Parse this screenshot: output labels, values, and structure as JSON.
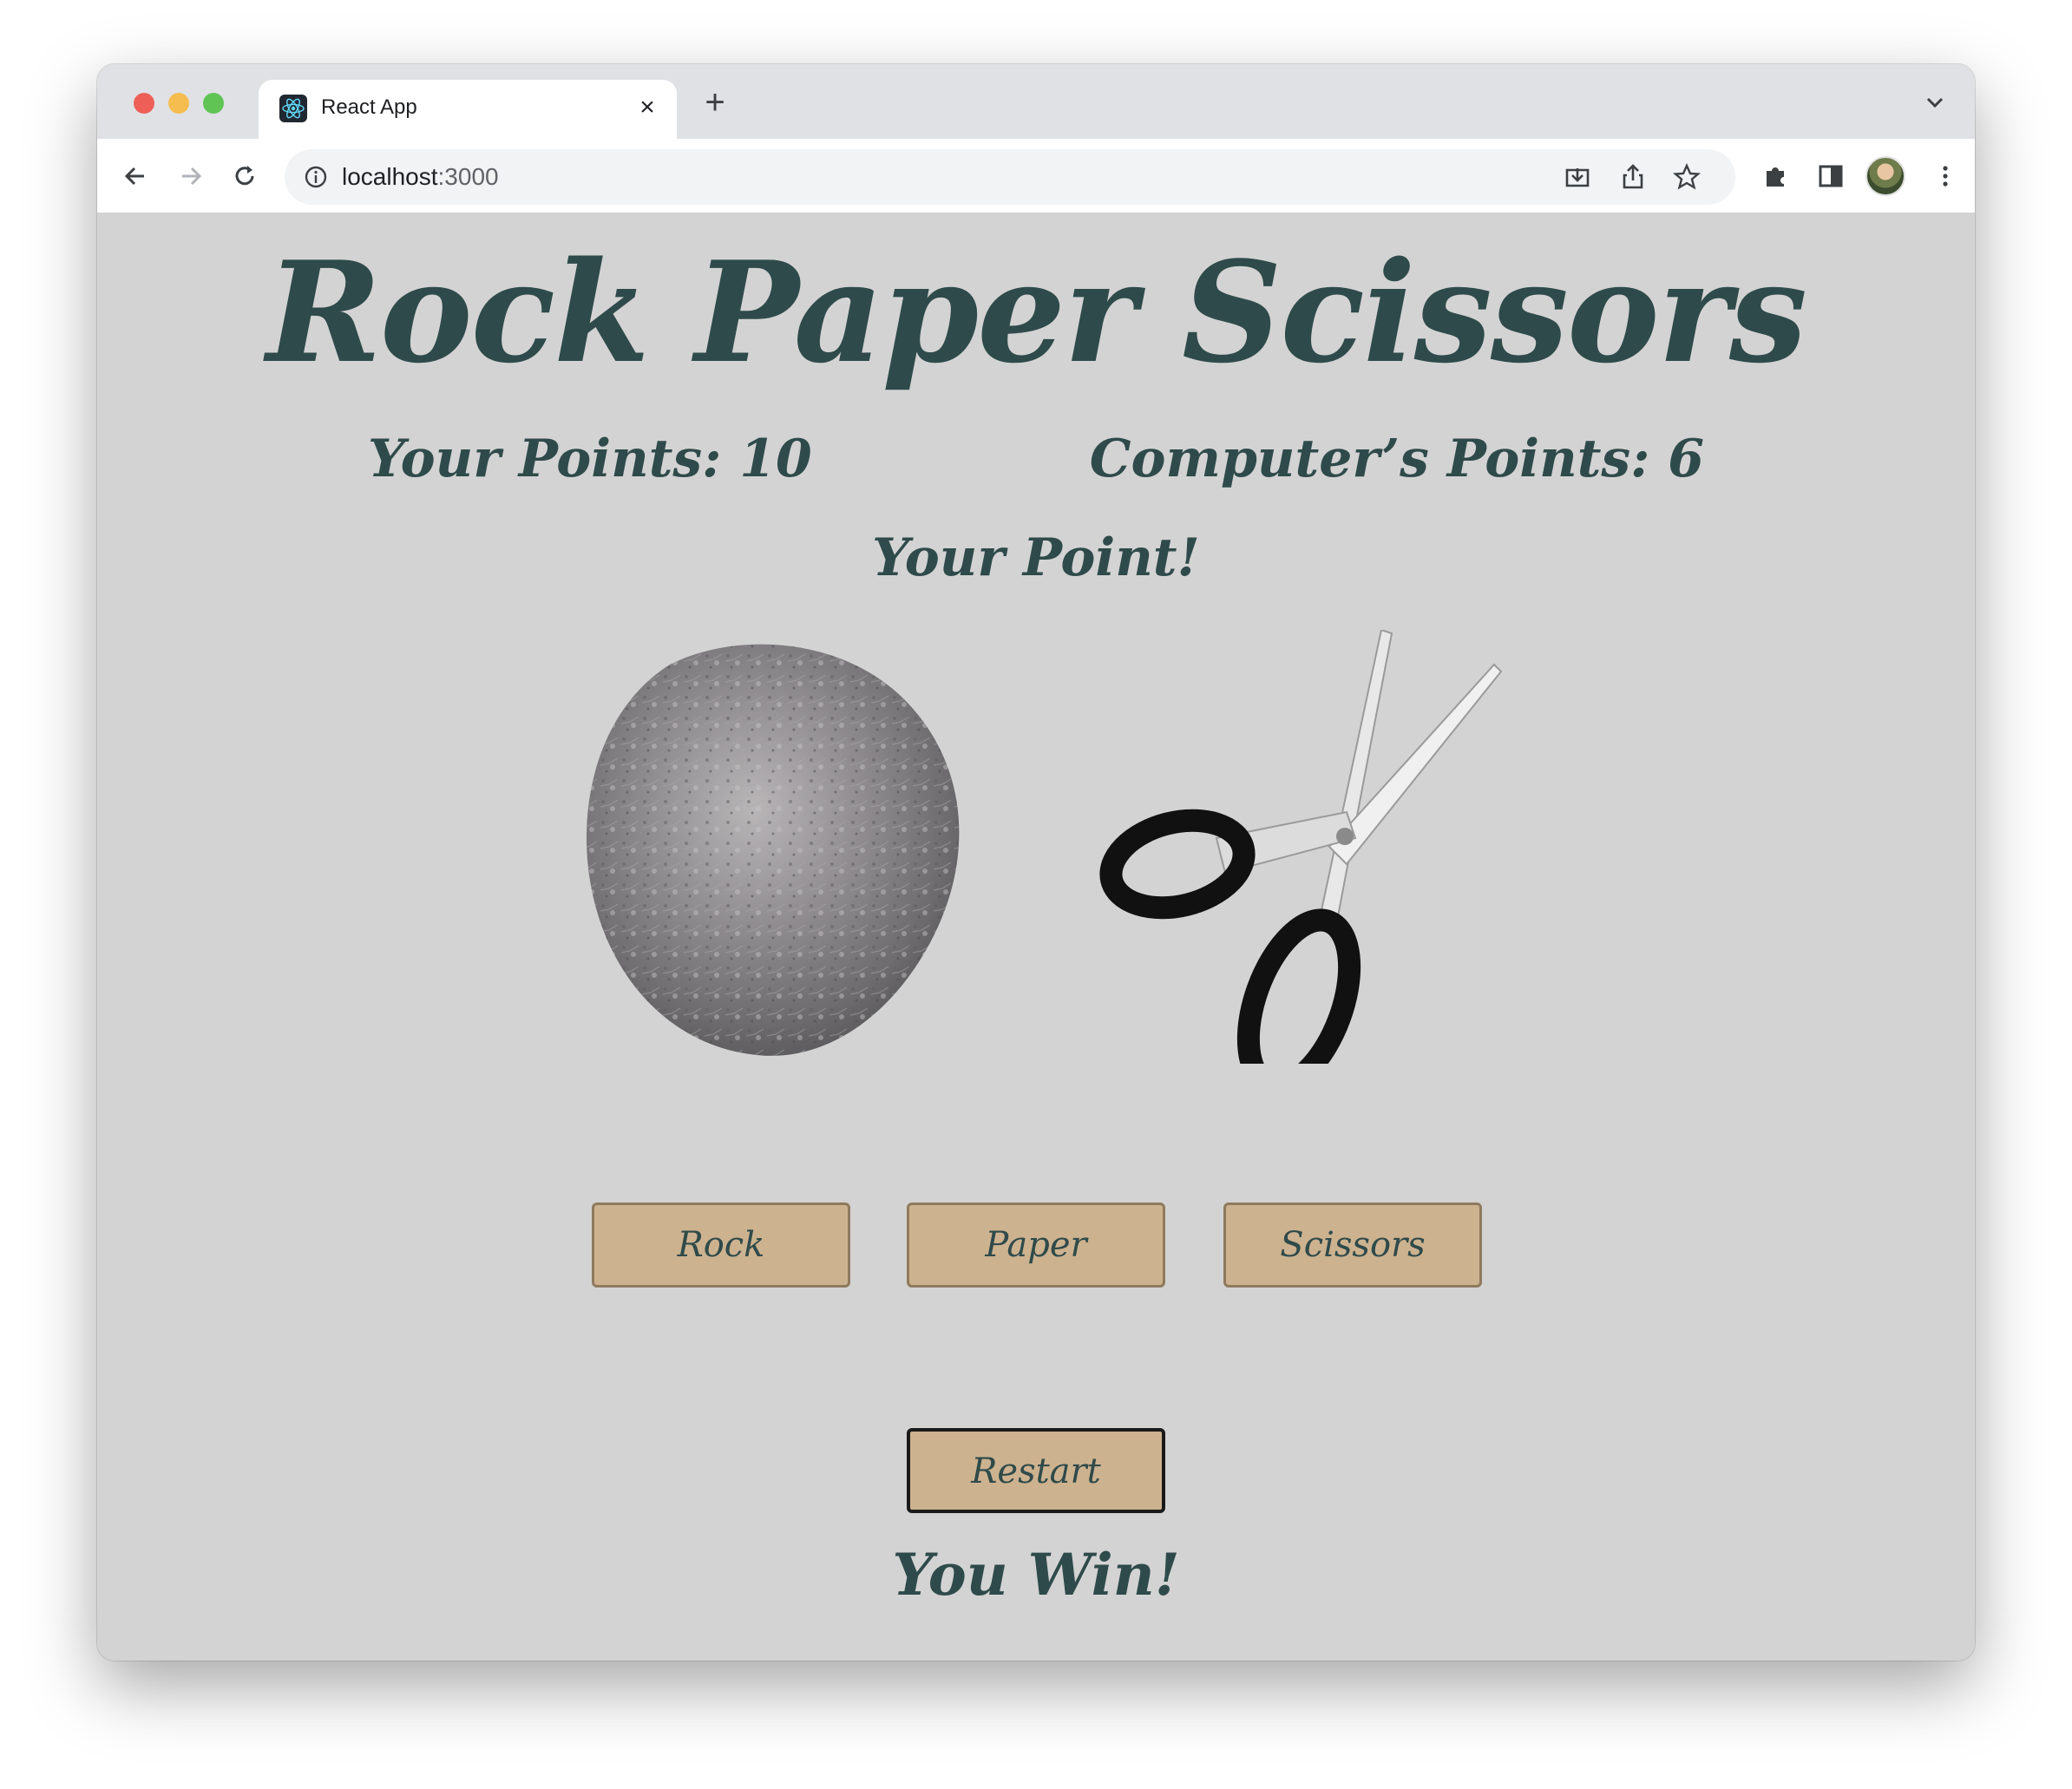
{
  "browser": {
    "tab_title": "React App",
    "url_host": "localhost",
    "url_port": ":3000"
  },
  "game": {
    "title": "Rock Paper Scissors",
    "user_points_text": "Your Points: 10",
    "computer_points_text": "Computer’s Points: 6",
    "round_result": "Your Point!",
    "user_choice": "rock",
    "computer_choice": "scissors",
    "buttons": {
      "rock": "Rock",
      "paper": "Paper",
      "scissors": "Scissors",
      "restart": "Restart"
    },
    "final_result": "You Win!"
  },
  "colors": {
    "page_bg": "#d3d3d3",
    "text": "#2f4a4a",
    "button_bg": "#cdb28f"
  }
}
